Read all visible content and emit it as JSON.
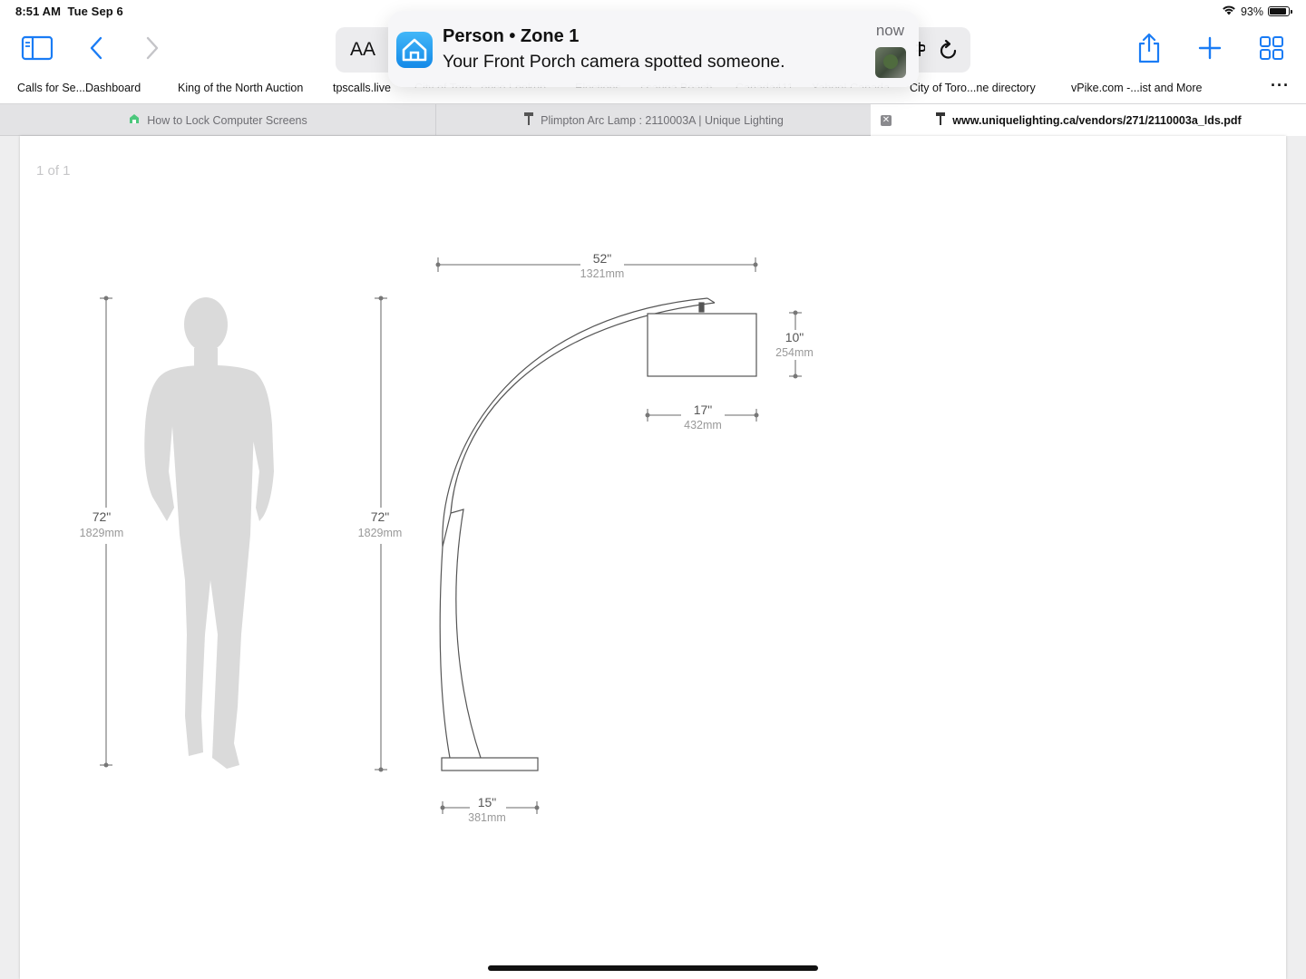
{
  "status_bar": {
    "time": "8:51 AM",
    "date": "Tue Sep 6",
    "battery": "93%",
    "battery_level": 0.93
  },
  "toolbar": {
    "reader_label": "AA"
  },
  "notification": {
    "title": "Person • Zone 1",
    "body": "Your Front Porch camera spotted someone.",
    "time": "now"
  },
  "bookmarks": [
    {
      "label": "Calls for Se...Dashboard"
    },
    {
      "label": "King of the North Auction"
    },
    {
      "label": "tpscalls.live"
    },
    {
      "label": "City of Toro...ence Lookup"
    },
    {
      "label": "Elections - ...ssauga Beach"
    },
    {
      "label": "Canada411"
    },
    {
      "label": "Yahoo! Canada"
    },
    {
      "label": "City of Toro...ne directory"
    },
    {
      "label": "vPike.com -...ist and More"
    }
  ],
  "tabs": [
    {
      "label": "How to Lock Computer Screens",
      "active": false
    },
    {
      "label": "Plimpton Arc Lamp : 2110003A | Unique Lighting",
      "active": false
    },
    {
      "label": "www.uniquelighting.ca/vendors/271/2110003a_lds.pdf",
      "active": true
    }
  ],
  "pdf": {
    "page_indicator": "1 of 1",
    "dimensions": {
      "person_height_in": "72\"",
      "person_height_mm": "1829mm",
      "lamp_height_in": "72\"",
      "lamp_height_mm": "1829mm",
      "lamp_reach_in": "52\"",
      "lamp_reach_mm": "1321mm",
      "shade_height_in": "10\"",
      "shade_height_mm": "254mm",
      "shade_width_in": "17\"",
      "shade_width_mm": "432mm",
      "base_width_in": "15\"",
      "base_width_mm": "381mm"
    }
  }
}
